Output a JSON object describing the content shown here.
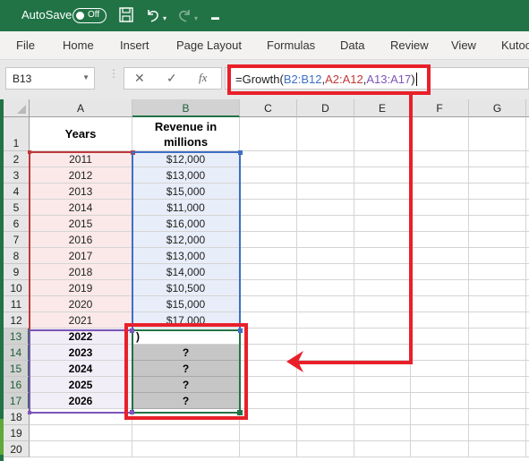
{
  "titlebar": {
    "autosave_label": "AutoSave",
    "autosave_state": "Off",
    "icons": [
      "save-icon",
      "undo-icon",
      "redo-icon",
      "customize-quick-access-icon"
    ]
  },
  "ribbon": {
    "tabs": [
      "File",
      "Home",
      "Insert",
      "Page Layout",
      "Formulas",
      "Data",
      "Review",
      "View",
      "Kutoo"
    ]
  },
  "formula_bar": {
    "name_box": "B13",
    "cancel_icon": "✕",
    "enter_icon": "✓",
    "fx_label": "fx",
    "formula_parts": {
      "prefix": "=Growth(",
      "ref1": "B2:B12",
      "sep1": ",",
      "ref2": "A2:A12",
      "sep2": ",",
      "ref3": "A13:A17",
      "suffix": ")"
    }
  },
  "sheet": {
    "columns": [
      "A",
      "B",
      "C",
      "D",
      "E",
      "F",
      "G"
    ],
    "selected_column": "B",
    "rows": [
      "1",
      "2",
      "3",
      "4",
      "5",
      "6",
      "7",
      "8",
      "9",
      "10",
      "11",
      "12",
      "13",
      "14",
      "15",
      "16",
      "17",
      "18",
      "19",
      "20"
    ],
    "header_row": {
      "A": "Years",
      "B_line1": "Revenue in",
      "B_line2": "millions"
    },
    "data": [
      {
        "year": "2011",
        "revenue": "$12,000"
      },
      {
        "year": "2012",
        "revenue": "$13,000"
      },
      {
        "year": "2013",
        "revenue": "$15,000"
      },
      {
        "year": "2014",
        "revenue": "$11,000"
      },
      {
        "year": "2015",
        "revenue": "$16,000"
      },
      {
        "year": "2016",
        "revenue": "$12,000"
      },
      {
        "year": "2017",
        "revenue": "$13,000"
      },
      {
        "year": "2018",
        "revenue": "$14,000"
      },
      {
        "year": "2019",
        "revenue": "$10,500"
      },
      {
        "year": "2020",
        "revenue": "$15,000"
      },
      {
        "year": "2021",
        "revenue": "$17,000"
      }
    ],
    "forecast": [
      {
        "year": "2022",
        "revenue": ")"
      },
      {
        "year": "2023",
        "revenue": "?"
      },
      {
        "year": "2024",
        "revenue": "?"
      },
      {
        "year": "2025",
        "revenue": "?"
      },
      {
        "year": "2026",
        "revenue": "?"
      }
    ]
  },
  "colors": {
    "excel_green": "#217346",
    "annotation_red": "#e8202a",
    "ref_blue": "#3f6fc4",
    "ref_red": "#c0393b",
    "ref_purple": "#7d55b8",
    "pink_fill": "#fbe9e9",
    "blue_fill": "#e8eef9",
    "purple_fill": "#f2eef8",
    "gray_fill": "#c6c6c6"
  }
}
